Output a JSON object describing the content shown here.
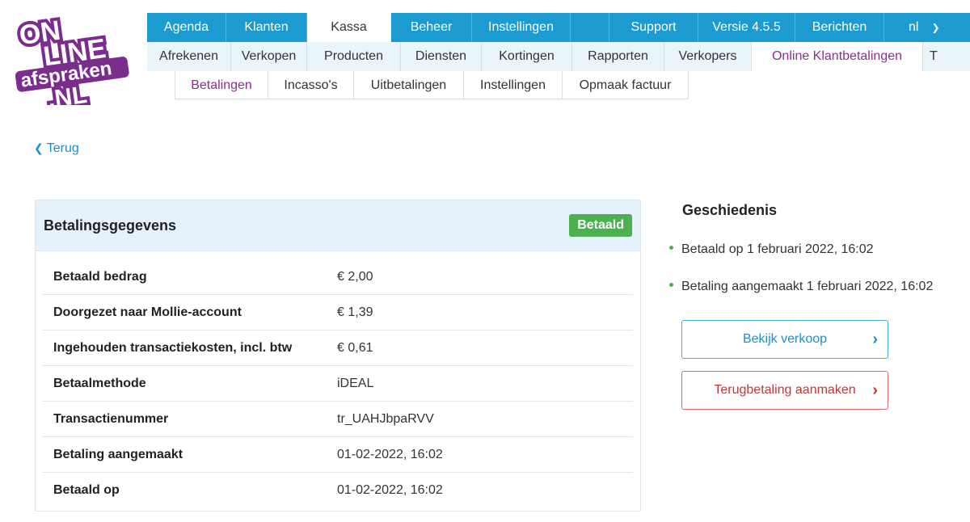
{
  "logo": {
    "line1": "ON",
    "line2": "LINE",
    "line3": "afspraken",
    "line4": ".NL"
  },
  "top_nav": [
    {
      "label": "Agenda",
      "active": false
    },
    {
      "label": "Klanten",
      "active": false
    },
    {
      "label": "Kassa",
      "active": true
    },
    {
      "label": "Beheer",
      "active": false
    },
    {
      "label": "Instellingen",
      "active": false
    },
    {
      "label": "",
      "active": false
    },
    {
      "label": "Support",
      "active": false
    },
    {
      "label": "Versie 4.5.5",
      "active": false
    },
    {
      "label": "Berichten",
      "active": false
    },
    {
      "label": "nl",
      "active": false
    }
  ],
  "sub_nav": [
    {
      "label": "Afrekenen",
      "active": false
    },
    {
      "label": "Verkopen",
      "active": false
    },
    {
      "label": "Producten",
      "active": false
    },
    {
      "label": "Diensten",
      "active": false
    },
    {
      "label": "Kortingen",
      "active": false
    },
    {
      "label": "Rapporten",
      "active": false
    },
    {
      "label": "Verkopers",
      "active": false
    },
    {
      "label": "Online Klantbetalingen",
      "active": true
    },
    {
      "label": "T",
      "active": false
    }
  ],
  "sub_nav2": [
    {
      "label": "Betalingen",
      "active": true
    },
    {
      "label": "Incasso's",
      "active": false
    },
    {
      "label": "Uitbetalingen",
      "active": false
    },
    {
      "label": "Instellingen",
      "active": false
    },
    {
      "label": "Opmaak factuur",
      "active": false
    }
  ],
  "back_label": "Terug",
  "panel": {
    "title": "Betalingsgegevens",
    "status": "Betaald",
    "rows": [
      {
        "label": "Betaald bedrag",
        "value": "€ 2,00"
      },
      {
        "label": "Doorgezet naar Mollie-account",
        "value": "€ 1,39"
      },
      {
        "label": "Ingehouden transactiekosten, incl. btw",
        "value": "€ 0,61"
      },
      {
        "label": "Betaalmethode",
        "value": "iDEAL"
      },
      {
        "label": "Transactienummer",
        "value": "tr_UAHJbpaRVV"
      },
      {
        "label": "Betaling aangemaakt",
        "value": "01-02-2022, 16:02"
      },
      {
        "label": "Betaald op",
        "value": "01-02-2022, 16:02"
      }
    ]
  },
  "history": {
    "title": "Geschiedenis",
    "items": [
      "Betaald op 1 februari 2022, 16:02",
      "Betaling aangemaakt 1 februari 2022, 16:02"
    ]
  },
  "buttons": {
    "view_sale": "Bekijk verkoop",
    "refund": "Terugbetaling aanmaken"
  },
  "colors": {
    "nav_blue": "#1b9bcf",
    "active_purple": "#8b2f8f",
    "badge_green": "#4caf50",
    "logo_purple": "#7b2d8e"
  }
}
